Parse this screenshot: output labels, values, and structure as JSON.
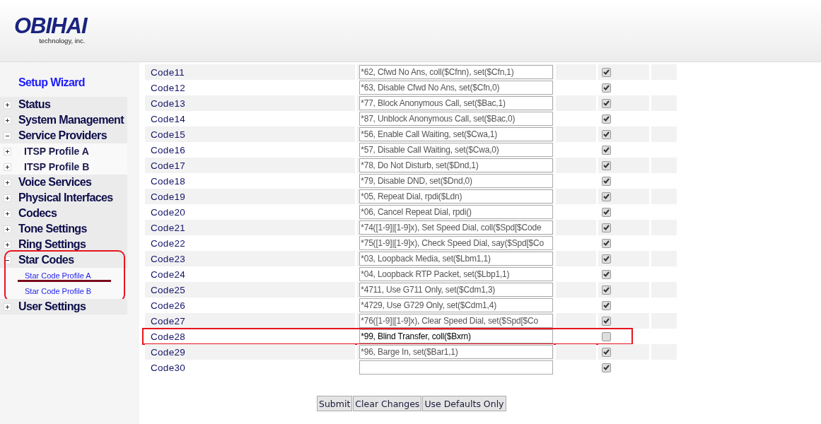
{
  "header": {
    "logo": "OBIHAI",
    "tagline": "technology, inc."
  },
  "sidebar": {
    "wizard": "Setup Wizard",
    "items": [
      {
        "label": "Status",
        "expanded": false
      },
      {
        "label": "System Management",
        "expanded": false
      },
      {
        "label": "Service Providers",
        "expanded": true,
        "children": [
          {
            "label": "ITSP Profile A",
            "kind": "group",
            "expanded": false,
            "marked": false
          },
          {
            "label": "ITSP Profile B",
            "kind": "group",
            "expanded": false,
            "marked": false
          }
        ]
      },
      {
        "label": "Voice Services",
        "expanded": false
      },
      {
        "label": "Physical Interfaces",
        "expanded": false
      },
      {
        "label": "Codecs",
        "expanded": false
      },
      {
        "label": "Tone Settings",
        "expanded": false
      },
      {
        "label": "Ring Settings",
        "expanded": false
      },
      {
        "label": "Star Codes",
        "expanded": true,
        "highlighted": true,
        "children": [
          {
            "label": "Star Code Profile A",
            "kind": "link",
            "marked": true
          },
          {
            "label": "Star Code Profile B",
            "kind": "link",
            "marked": false
          }
        ]
      },
      {
        "label": "User Settings",
        "expanded": false
      }
    ]
  },
  "table": {
    "rows": [
      {
        "label": "Code11",
        "value": "*62, Cfwd No Ans, coll($Cfnn), set($Cfn,1)",
        "checked": true
      },
      {
        "label": "Code12",
        "value": "*63, Disable Cfwd No Ans, set($Cfn,0)",
        "checked": true
      },
      {
        "label": "Code13",
        "value": "*77, Block Anonymous Call, set($Bac,1)",
        "checked": true
      },
      {
        "label": "Code14",
        "value": "*87, Unblock Anonymous Call, set($Bac,0)",
        "checked": true
      },
      {
        "label": "Code15",
        "value": "*56, Enable Call Waiting, set($Cwa,1)",
        "checked": true
      },
      {
        "label": "Code16",
        "value": "*57, Disable Call Waiting, set($Cwa,0)",
        "checked": true
      },
      {
        "label": "Code17",
        "value": "*78, Do Not Disturb, set($Dnd,1)",
        "checked": true
      },
      {
        "label": "Code18",
        "value": "*79, Disable DND, set($Dnd,0)",
        "checked": true
      },
      {
        "label": "Code19",
        "value": "*05, Repeat Dial, rpdi($Ldn)",
        "checked": true
      },
      {
        "label": "Code20",
        "value": "*06, Cancel Repeat Dial, rpdi()",
        "checked": true
      },
      {
        "label": "Code21",
        "value": "*74([1-9]|[1-9]x), Set Speed Dial, coll($Spd[$Code",
        "checked": true
      },
      {
        "label": "Code22",
        "value": "*75([1-9]|[1-9]x), Check Speed Dial, say($Spd[$Co",
        "checked": true
      },
      {
        "label": "Code23",
        "value": "*03, Loopback Media, set($Lbm1,1)",
        "checked": true
      },
      {
        "label": "Code24",
        "value": "*04, Loopback RTP Packet, set($Lbp1,1)",
        "checked": true
      },
      {
        "label": "Code25",
        "value": "*4711, Use G711 Only, set($Cdm1,3)",
        "checked": true
      },
      {
        "label": "Code26",
        "value": "*4729, Use G729 Only, set($Cdm1,4)",
        "checked": true
      },
      {
        "label": "Code27",
        "value": "*76([1-9]|[1-9]x), Clear Speed Dial, set($Spd[$Co",
        "checked": true
      },
      {
        "label": "Code28",
        "value": "*99, Blind Transfer, coll($Bxrn)",
        "checked": false,
        "highlighted": true
      },
      {
        "label": "Code29",
        "value": "*96, Barge In, set($Bar1,1)",
        "checked": true
      },
      {
        "label": "Code30",
        "checked": true
      }
    ]
  },
  "buttons": [
    "Submit",
    "Clear Changes",
    "Use Defaults Only"
  ]
}
